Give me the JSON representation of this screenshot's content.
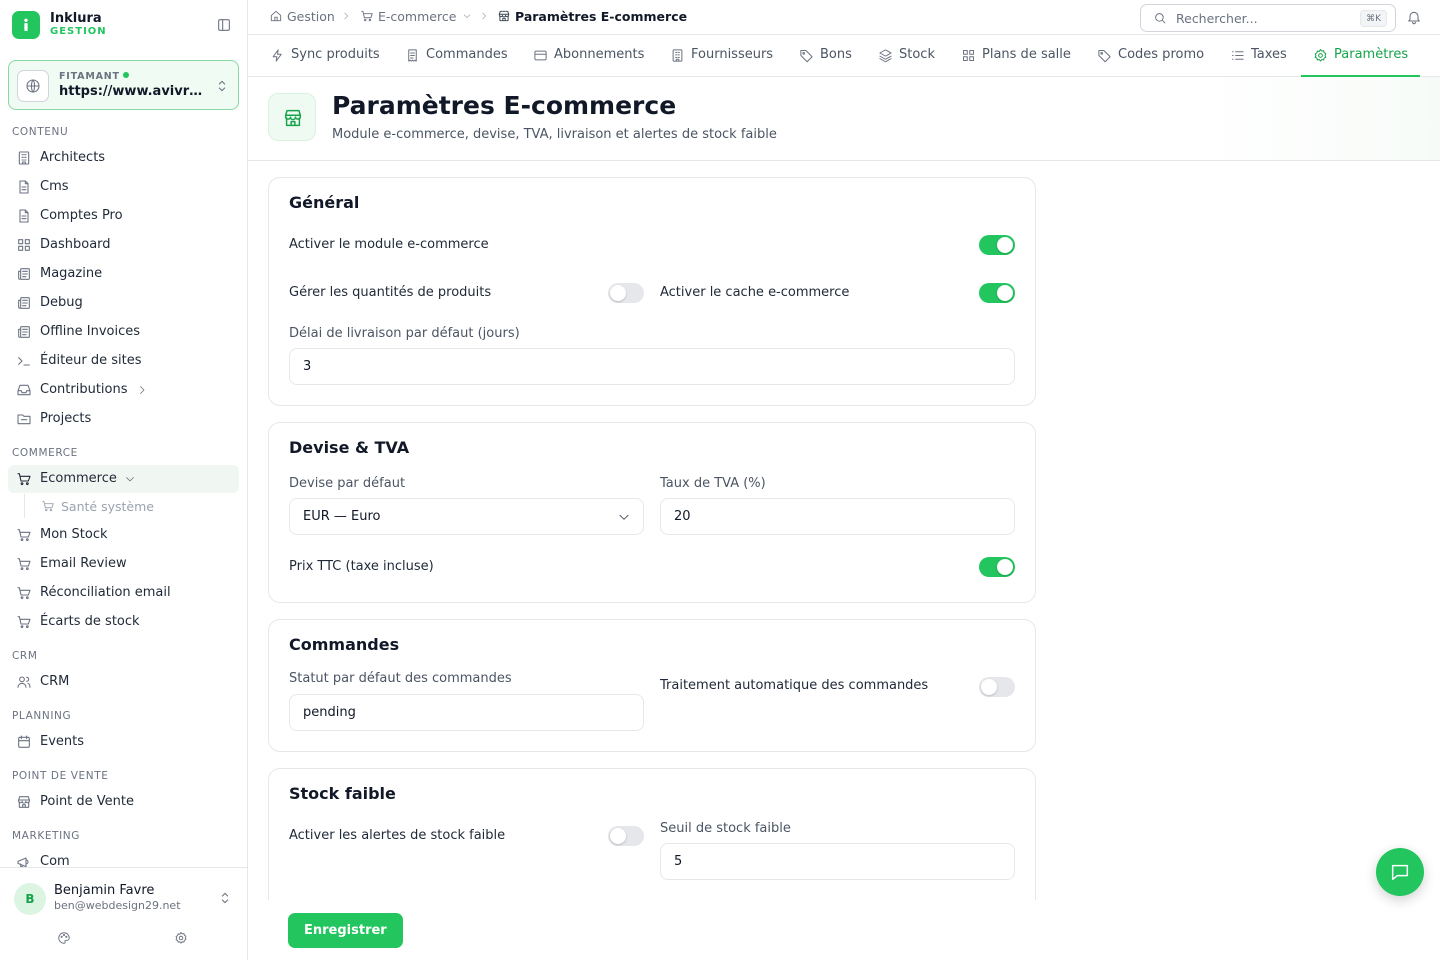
{
  "brand": {
    "name": "Inklura",
    "sub": "GESTION"
  },
  "site": {
    "label": "FITAMANT",
    "url": "https://www.avivre.fr"
  },
  "sidebar": {
    "sections": [
      {
        "title": "CONTENU",
        "items": [
          {
            "label": "Architects",
            "icon": "building-icon"
          },
          {
            "label": "Cms",
            "icon": "document-icon"
          },
          {
            "label": "Comptes Pro",
            "icon": "document-icon"
          },
          {
            "label": "Dashboard",
            "icon": "grid-icon"
          },
          {
            "label": "Magazine",
            "icon": "newspaper-icon"
          },
          {
            "label": "Debug",
            "icon": "newspaper-icon"
          },
          {
            "label": "Offline Invoices",
            "icon": "newspaper-icon"
          },
          {
            "label": "Éditeur de sites",
            "icon": "terminal-icon"
          },
          {
            "label": "Contributions",
            "icon": "inbox-icon"
          },
          {
            "label": "Projects",
            "icon": "folder-icon"
          }
        ]
      },
      {
        "title": "COMMERCE",
        "items": [
          {
            "label": "Ecommerce",
            "icon": "cart-icon",
            "sub": "Santé système"
          },
          {
            "label": "Mon Stock",
            "icon": "cart-icon"
          },
          {
            "label": "Email Review",
            "icon": "cart-icon"
          },
          {
            "label": "Réconciliation email",
            "icon": "cart-icon"
          },
          {
            "label": "Écarts de stock",
            "icon": "cart-icon"
          }
        ]
      },
      {
        "title": "CRM",
        "items": [
          {
            "label": "CRM",
            "icon": "users-icon"
          }
        ]
      },
      {
        "title": "PLANNING",
        "items": [
          {
            "label": "Events",
            "icon": "calendar-icon"
          }
        ]
      },
      {
        "title": "POINT DE VENTE",
        "items": [
          {
            "label": "Point de Vente",
            "icon": "store-icon"
          }
        ]
      },
      {
        "title": "MARKETING",
        "items": [
          {
            "label": "Com",
            "icon": "megaphone-icon"
          }
        ]
      }
    ]
  },
  "user": {
    "initial": "B",
    "name": "Benjamin Favre",
    "email": "ben@webdesign29.net"
  },
  "breadcrumb": {
    "root": "Gestion",
    "parent": "E-commerce",
    "current": "Paramètres E-commerce"
  },
  "search": {
    "placeholder": "Rechercher...",
    "shortcut": "⌘K"
  },
  "tabs": [
    {
      "label": "Sync produits",
      "icon": "zap-icon"
    },
    {
      "label": "Commandes",
      "icon": "receipt-icon"
    },
    {
      "label": "Abonnements",
      "icon": "card-icon"
    },
    {
      "label": "Fournisseurs",
      "icon": "building-icon"
    },
    {
      "label": "Bons",
      "icon": "tag-icon"
    },
    {
      "label": "Stock",
      "icon": "layers-icon"
    },
    {
      "label": "Plans de salle",
      "icon": "grid-icon"
    },
    {
      "label": "Codes promo",
      "icon": "tag-icon"
    },
    {
      "label": "Taxes",
      "icon": "list-icon"
    },
    {
      "label": "Paramètres",
      "icon": "gear-icon",
      "active": true
    }
  ],
  "page": {
    "title": "Paramètres E-commerce",
    "description": "Module e-commerce, devise, TVA, livraison et alertes de stock faible"
  },
  "general": {
    "title": "Général",
    "enable_module": {
      "label": "Activer le module e-commerce",
      "on": true
    },
    "manage_quantities": {
      "label": "Gérer les quantités de produits",
      "on": false
    },
    "enable_cache": {
      "label": "Activer le cache e-commerce",
      "on": true
    },
    "delivery_delay": {
      "label": "Délai de livraison par défaut (jours)",
      "value": "3"
    }
  },
  "currency": {
    "title": "Devise & TVA",
    "default_currency": {
      "label": "Devise par défaut",
      "value": "EUR — Euro"
    },
    "vat_rate": {
      "label": "Taux de TVA (%)",
      "value": "20"
    },
    "prices_ttc": {
      "label": "Prix TTC (taxe incluse)",
      "on": true
    }
  },
  "orders": {
    "title": "Commandes",
    "default_status": {
      "label": "Statut par défaut des commandes",
      "value": "pending"
    },
    "auto_processing": {
      "label": "Traitement automatique des commandes",
      "on": false
    }
  },
  "low_stock": {
    "title": "Stock faible",
    "enable_alerts": {
      "label": "Activer les alertes de stock faible",
      "on": false
    },
    "threshold": {
      "label": "Seuil de stock faible",
      "value": "5"
    }
  },
  "footer": {
    "save_label": "Enregistrer"
  },
  "colors": {
    "accent": "#22c55e",
    "accent_dark": "#16a34a",
    "toggle_off": "#e5e7eb"
  }
}
